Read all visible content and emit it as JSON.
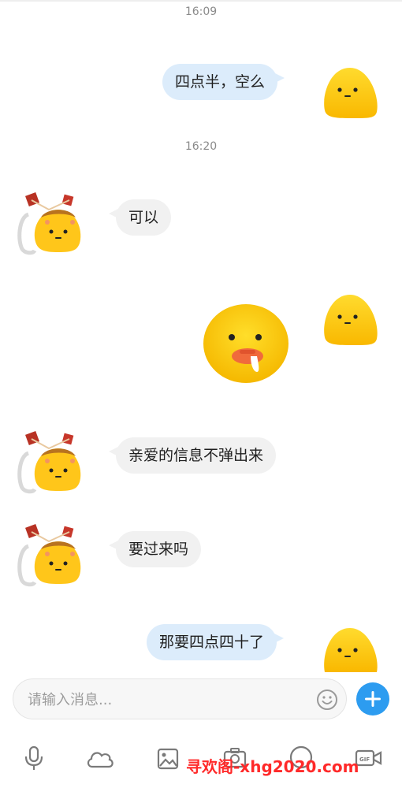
{
  "chat": {
    "time1": "16:09",
    "msg1": "四点半，空么",
    "time2": "16:20",
    "msg2": "可以",
    "msg4": "亲爱的信息不弹出来",
    "msg5": "要过来吗",
    "msg6": "那要四点四十了"
  },
  "input": {
    "placeholder": "请输入消息..."
  },
  "watermark": "寻欢阁-xhg2020.com",
  "toolbar": {
    "icons": [
      "microphone-icon",
      "cloud-icon",
      "image-icon",
      "camera-icon",
      "gif-icon",
      "video-icon"
    ]
  },
  "colors": {
    "outgoing_bubble": "#dcecfb",
    "incoming_bubble": "#f1f1f1",
    "accent": "#2d9cf0",
    "watermark": "#ff2a2a"
  }
}
